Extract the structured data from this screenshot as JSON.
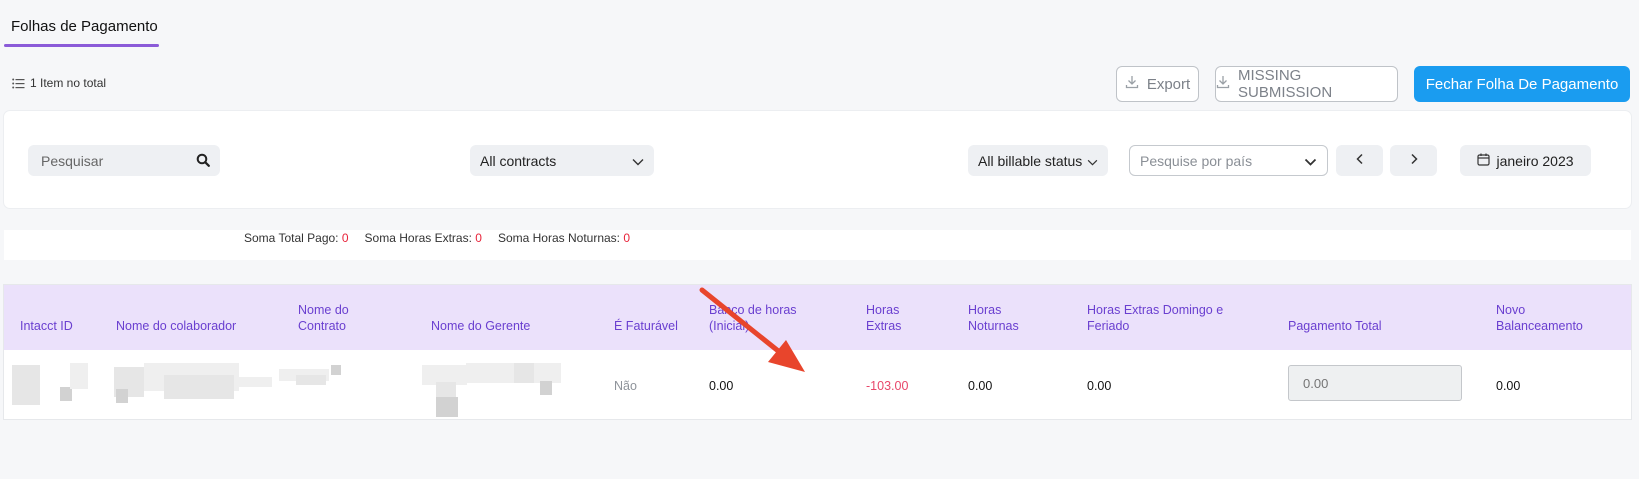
{
  "tabs": [
    {
      "label": "Folhas de Pagamento",
      "active": true
    }
  ],
  "item_count": "1 Item no total",
  "toolbar": {
    "export_label": "Export",
    "missing_label": "MISSING SUBMISSION",
    "fechar_label": "Fechar Folha De Pagamento"
  },
  "filters": {
    "search_placeholder": "Pesquisar",
    "contracts": "All contracts",
    "billable": "All billable status",
    "pais_placeholder": "Pesquise por país",
    "date": "janeiro 2023"
  },
  "totals": [
    {
      "label": "Soma Total Pago:",
      "value": "0"
    },
    {
      "label": "Soma Horas Extras:",
      "value": "0"
    },
    {
      "label": "Soma Horas Noturnas:",
      "value": "0"
    }
  ],
  "table": {
    "headers": [
      "Intacct ID",
      "Nome do colaborador",
      "Nome do Contrato",
      "Nome do Gerente",
      "É Faturável",
      "Banco de horas (Inicial)",
      "Horas Extras",
      "Horas Noturnas",
      "Horas Extras Domingo e Feriado",
      "Pagamento Total",
      "Novo Balanceamento"
    ],
    "rows": [
      {
        "faturavel": "Não",
        "banco_horas": "0.00",
        "horas_extras": "-103.00",
        "horas_noturnas": "0.00",
        "horas_domingo": "0.00",
        "pagamento_total": "0.00",
        "novo_balanceamento": "0.00"
      }
    ]
  },
  "colors": {
    "accent": "#8b5bd8",
    "primary_button": "#1a9cf0",
    "header_bg": "#ebe1fb",
    "header_text": "#6a3fd0",
    "negative": "#e8476a",
    "annotation_arrow": "#e8452c"
  }
}
